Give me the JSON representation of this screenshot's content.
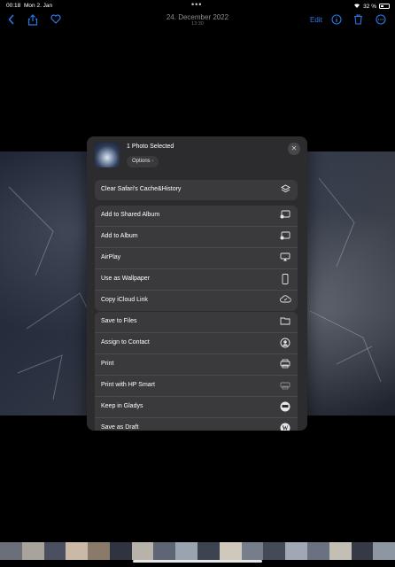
{
  "status": {
    "time": "00:18",
    "date": "Mon 2. Jan",
    "battery": "32 %"
  },
  "toolbar": {
    "title": "24. December 2022",
    "subtitle": "13:30",
    "edit_label": "Edit"
  },
  "sheet": {
    "title": "1 Photo Selected",
    "options_label": "Options",
    "groups": [
      [
        {
          "label": "Clear Safari's Cache&History",
          "icon": "layers-icon"
        }
      ],
      [
        {
          "label": "Add to Shared Album",
          "icon": "shared-album-icon"
        },
        {
          "label": "Add to Album",
          "icon": "album-icon"
        },
        {
          "label": "AirPlay",
          "icon": "airplay-icon"
        },
        {
          "label": "Use as Wallpaper",
          "icon": "phone-icon"
        },
        {
          "label": "Copy iCloud Link",
          "icon": "cloud-link-icon"
        }
      ],
      [
        {
          "label": "Save to Files",
          "icon": "folder-icon"
        },
        {
          "label": "Assign to Contact",
          "icon": "contact-icon"
        },
        {
          "label": "Print",
          "icon": "printer-icon"
        },
        {
          "label": "Print with HP Smart",
          "icon": "hp-printer-icon"
        },
        {
          "label": "Keep in Gladys",
          "icon": "gladys-icon"
        },
        {
          "label": "Save as Draft",
          "icon": "wordpress-icon"
        }
      ]
    ]
  },
  "colors": {
    "accent": "#2b79e8",
    "sheet_bg": "#2c2c2e",
    "row_bg": "#3a3a3c"
  }
}
